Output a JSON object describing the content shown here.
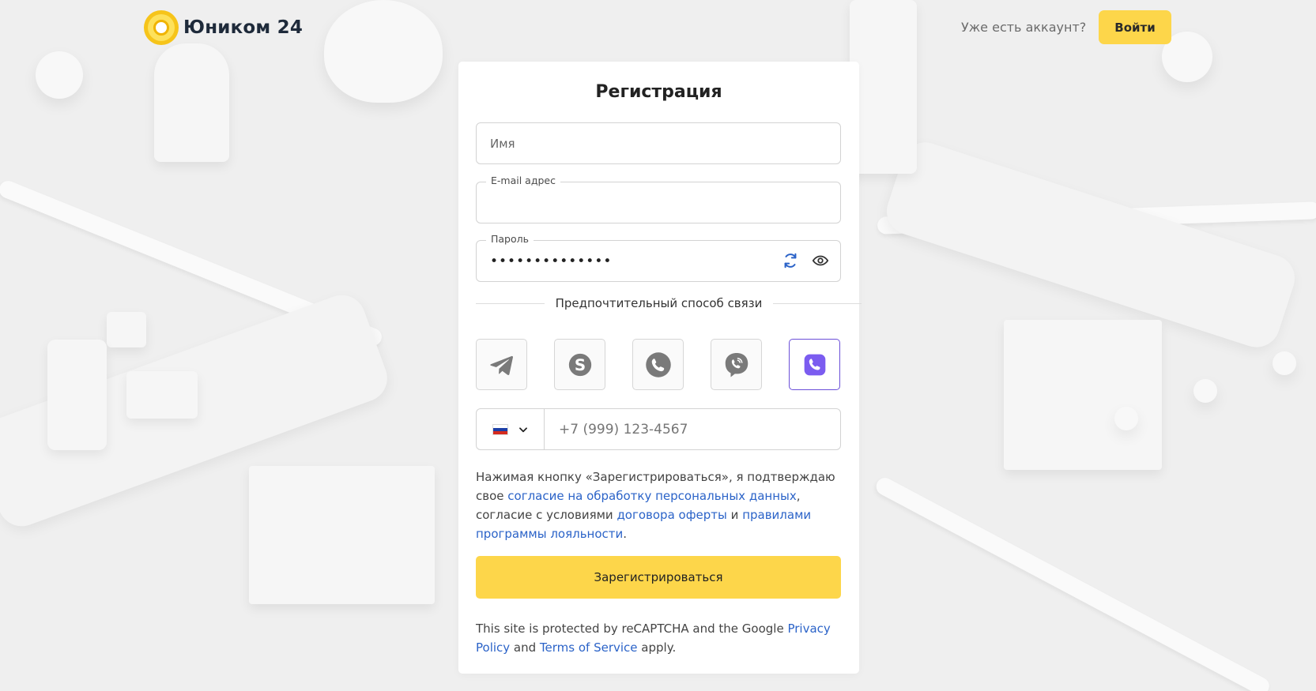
{
  "header": {
    "brand": "Юником 24",
    "have_account": "Уже есть аккаунт?",
    "login_label": "Войти"
  },
  "form": {
    "title": "Регистрация",
    "name_placeholder": "Имя",
    "email_label": "E-mail адрес",
    "email_value": "",
    "password_label": "Пароль",
    "password_value": "••••••••••••••",
    "contact_heading": "Предпочтительный способ связи",
    "contacts": [
      {
        "name": "telegram-icon",
        "selected": false
      },
      {
        "name": "skype-icon",
        "selected": false
      },
      {
        "name": "whatsapp-icon",
        "selected": false
      },
      {
        "name": "viber-icon",
        "selected": false
      },
      {
        "name": "phone-icon",
        "selected": true
      }
    ],
    "phone": {
      "country": "RU",
      "placeholder": "+7 (999) 123-4567"
    },
    "consent": {
      "part1": "Нажимая кнопку «Зарегистрироваться», я подтверждаю свое ",
      "link1": "согласие на обработку персональных данных",
      "part2": ", согласие с условиями ",
      "link2": "договора оферты",
      "part3": " и ",
      "link3": "правилами программы лояльности",
      "part4": "."
    },
    "submit_label": "Зарегистрироваться",
    "recaptcha": {
      "part1": "This site is protected by reCAPTCHA and the Google ",
      "link1": "Privacy Policy",
      "part2": " and ",
      "link2": "Terms of Service",
      "part3": " apply."
    }
  },
  "colors": {
    "accent": "#fdd64a",
    "link": "#2b63c8",
    "selected_border": "#6b4fd8",
    "selected_icon": "#7b5cf0"
  }
}
